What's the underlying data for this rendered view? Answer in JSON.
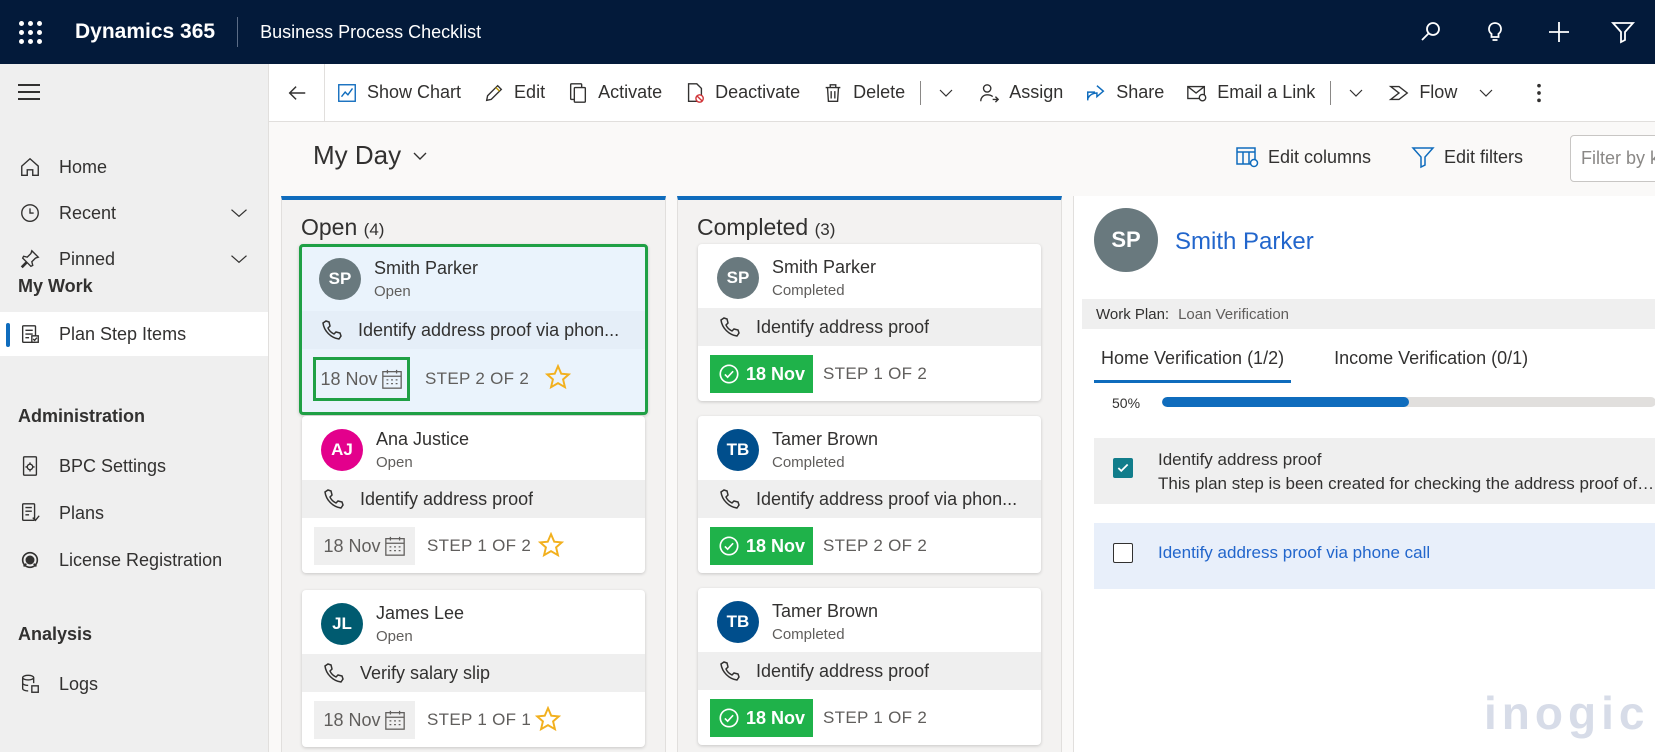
{
  "topbar": {
    "brand": "Dynamics 365",
    "app_title": "Business Process Checklist"
  },
  "sidenav": {
    "items": [
      {
        "label": "Home"
      },
      {
        "label": "Recent"
      },
      {
        "label": "Pinned"
      }
    ],
    "groups": [
      {
        "title": "My Work",
        "items": [
          {
            "label": "Plan Step Items",
            "active": true
          }
        ]
      },
      {
        "title": "Administration",
        "items": [
          {
            "label": "BPC Settings"
          },
          {
            "label": "Plans"
          },
          {
            "label": "License Registration"
          }
        ]
      },
      {
        "title": "Analysis",
        "items": [
          {
            "label": "Logs"
          }
        ]
      }
    ]
  },
  "commandbar": {
    "show_chart": "Show Chart",
    "edit": "Edit",
    "activate": "Activate",
    "deactivate": "Deactivate",
    "delete": "Delete",
    "assign": "Assign",
    "share": "Share",
    "email_link": "Email a Link",
    "flow": "Flow"
  },
  "view": {
    "title": "My Day",
    "edit_columns": "Edit columns",
    "edit_filters": "Edit filters",
    "filter_placeholder": "Filter by k"
  },
  "columns": {
    "open": {
      "title": "Open",
      "count": "(4)",
      "cards": [
        {
          "initials": "SP",
          "avatar_color": "#69797e",
          "name": "Smith Parker",
          "status": "Open",
          "task": "Identify address proof via phon...",
          "date": "18 Nov",
          "step": "STEP 2 OF 2",
          "starred": true,
          "selected": true
        },
        {
          "initials": "AJ",
          "avatar_color": "#e3008c",
          "name": "Ana Justice",
          "status": "Open",
          "task": "Identify address proof",
          "date": "18 Nov",
          "step": "STEP 1 OF 2",
          "starred": true
        },
        {
          "initials": "JL",
          "avatar_color": "#005b70",
          "name": "James Lee",
          "status": "Open",
          "task": "Verify salary slip",
          "date": "18 Nov",
          "step": "STEP 1 OF 1",
          "starred": true
        }
      ]
    },
    "completed": {
      "title": "Completed",
      "count": "(3)",
      "cards": [
        {
          "initials": "SP",
          "avatar_color": "#69797e",
          "name": "Smith Parker",
          "status": "Completed",
          "task": "Identify address proof",
          "date": "18 Nov",
          "step": "STEP 1 OF 2"
        },
        {
          "initials": "TB",
          "avatar_color": "#004e8c",
          "name": "Tamer Brown",
          "status": "Completed",
          "task": "Identify address proof via phon...",
          "date": "18 Nov",
          "step": "STEP 2 OF 2"
        },
        {
          "initials": "TB",
          "avatar_color": "#004e8c",
          "name": "Tamer Brown",
          "status": "Completed",
          "task": "Identify address proof",
          "date": "18 Nov",
          "step": "STEP 1 OF 2"
        }
      ]
    }
  },
  "detail": {
    "initials": "SP",
    "name": "Smith Parker",
    "work_plan_label": "Work Plan:",
    "work_plan_value": "Loan Verification",
    "tabs": [
      {
        "label": "Home Verification (1/2)",
        "active": true
      },
      {
        "label": "Income Verification (0/1)"
      }
    ],
    "progress_label": "50%",
    "progress_fraction": 0.5,
    "steps": [
      {
        "title": "Identify address proof",
        "description": "This plan step is been created for checking the address proof of the customer",
        "checked": true
      },
      {
        "title": "Identify address proof via phone call",
        "checked": false
      }
    ]
  },
  "watermark": "inogic",
  "colors": {
    "topbar": "#031a3a",
    "accent": "#0f6cbd",
    "done_green": "#1fb24a",
    "selection_green": "#1fa045",
    "star": "#f2b01e",
    "link": "#2266cc"
  }
}
